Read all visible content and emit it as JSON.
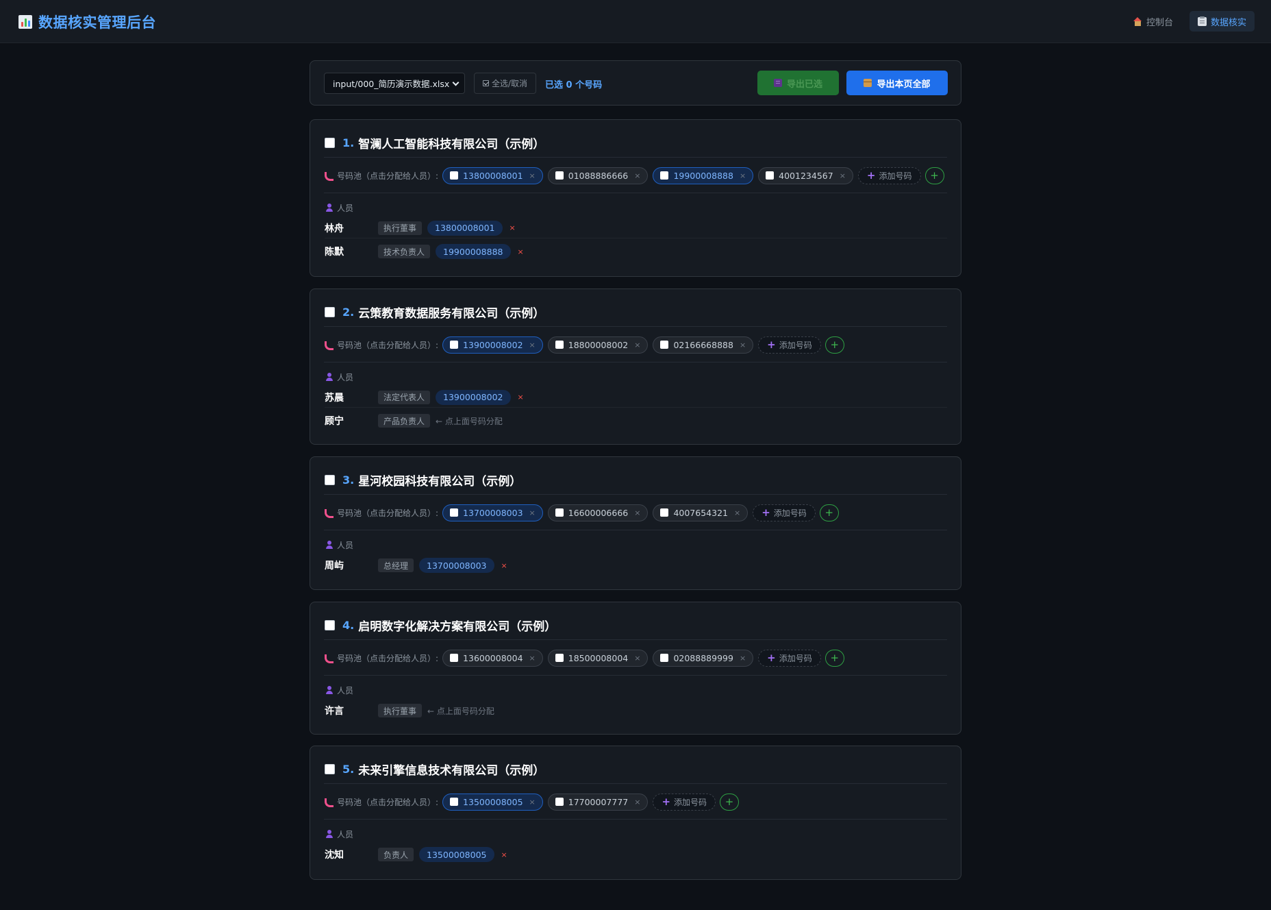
{
  "header": {
    "title": "数据核实管理后台",
    "nav": [
      {
        "label": "控制台",
        "icon": "house-icon",
        "active": false
      },
      {
        "label": "数据核实",
        "icon": "clipboard-icon",
        "active": true
      }
    ]
  },
  "toolbar": {
    "file_value": "input/000_简历演示数据.xlsx",
    "toggle_all_label": "全选/取消",
    "selected_count_text": "已选 0 个号码",
    "export_selected_label": "导出已选",
    "export_all_label": "导出本页全部"
  },
  "labels": {
    "pool": "号码池（点击分配给人员）:",
    "add_placeholder": "添加号码",
    "add_button": "+",
    "people": "人员",
    "assign_hint": "← 点上面号码分配",
    "remove": "×"
  },
  "companies": [
    {
      "index": "1.",
      "name": "智澜人工智能科技有限公司（示例）",
      "phones": [
        {
          "number": "13800008001",
          "assigned": true
        },
        {
          "number": "01088886666",
          "assigned": false
        },
        {
          "number": "19900008888",
          "assigned": true
        },
        {
          "number": "4001234567",
          "assigned": false
        }
      ],
      "people": [
        {
          "name": "林舟",
          "role": "执行董事",
          "phone": "13800008001"
        },
        {
          "name": "陈默",
          "role": "技术负责人",
          "phone": "19900008888"
        }
      ]
    },
    {
      "index": "2.",
      "name": "云策教育数据服务有限公司（示例）",
      "phones": [
        {
          "number": "13900008002",
          "assigned": true
        },
        {
          "number": "18800008002",
          "assigned": false
        },
        {
          "number": "02166668888",
          "assigned": false
        }
      ],
      "people": [
        {
          "name": "苏晨",
          "role": "法定代表人",
          "phone": "13900008002"
        },
        {
          "name": "顾宁",
          "role": "产品负责人",
          "phone": null
        }
      ]
    },
    {
      "index": "3.",
      "name": "星河校园科技有限公司（示例）",
      "phones": [
        {
          "number": "13700008003",
          "assigned": true
        },
        {
          "number": "16600006666",
          "assigned": false
        },
        {
          "number": "4007654321",
          "assigned": false
        }
      ],
      "people": [
        {
          "name": "周屿",
          "role": "总经理",
          "phone": "13700008003"
        }
      ]
    },
    {
      "index": "4.",
      "name": "启明数字化解决方案有限公司（示例）",
      "phones": [
        {
          "number": "13600008004",
          "assigned": false
        },
        {
          "number": "18500008004",
          "assigned": false
        },
        {
          "number": "02088889999",
          "assigned": false
        }
      ],
      "people": [
        {
          "name": "许言",
          "role": "执行董事",
          "phone": null
        }
      ]
    },
    {
      "index": "5.",
      "name": "未来引擎信息技术有限公司（示例）",
      "phones": [
        {
          "number": "13500008005",
          "assigned": true
        },
        {
          "number": "17700007777",
          "assigned": false
        }
      ],
      "people": [
        {
          "name": "沈知",
          "role": "负责人",
          "phone": "13500008005"
        }
      ]
    }
  ]
}
